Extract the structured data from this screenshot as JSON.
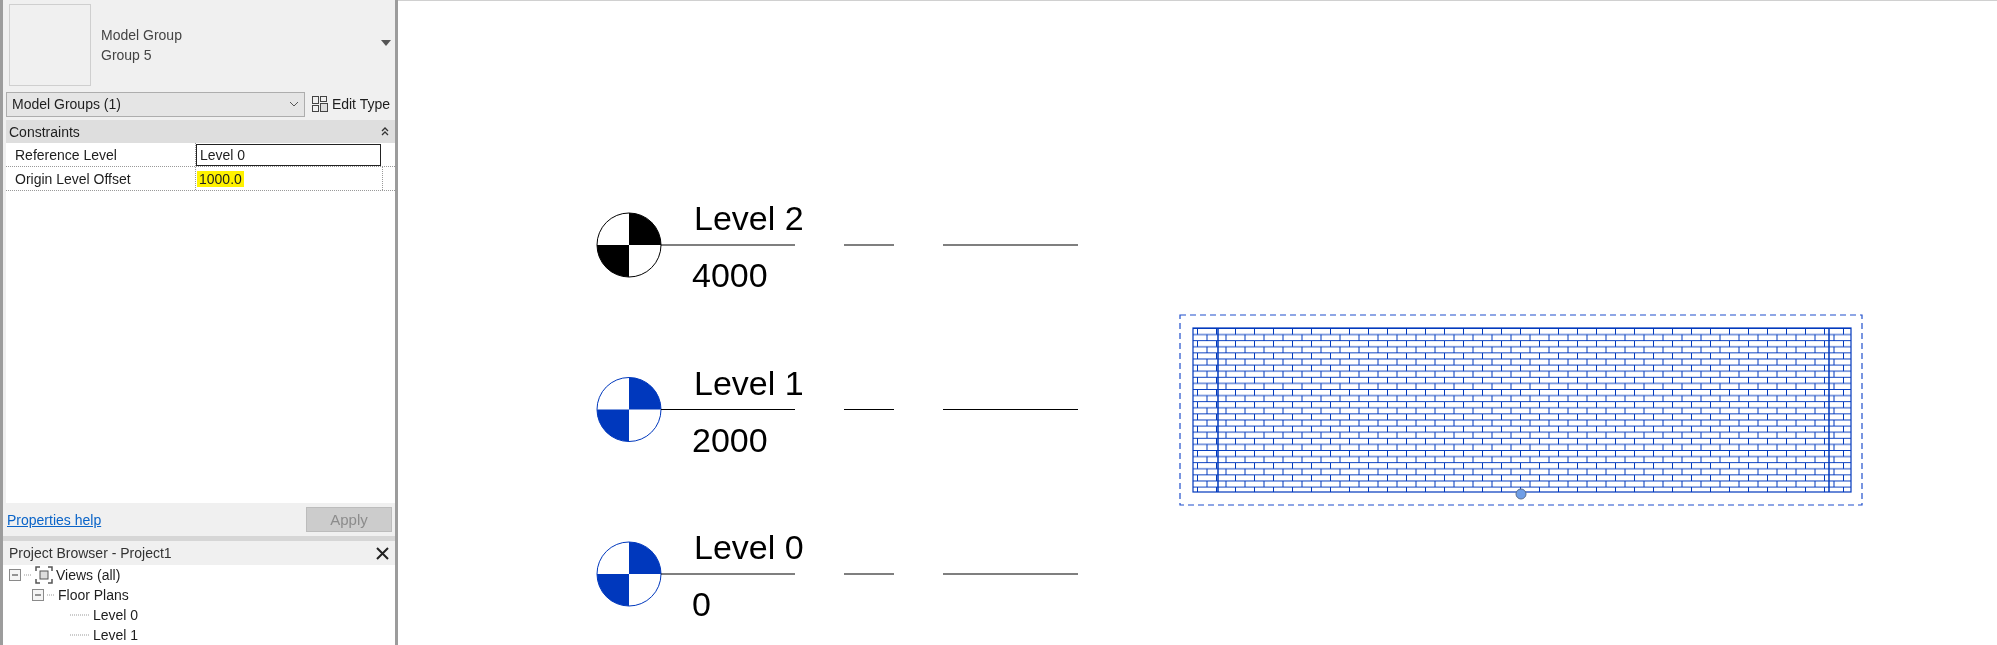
{
  "properties": {
    "type_preview": {
      "family": "Model Group",
      "type": "Group 5"
    },
    "selector": "Model Groups (1)",
    "edit_type": "Edit Type",
    "sections": [
      {
        "title": "Constraints",
        "expanded": true,
        "rows": [
          {
            "label": "Reference Level",
            "value": "Level 0",
            "editing": true,
            "highlighted": false
          },
          {
            "label": "Origin Level Offset",
            "value": "1000.0",
            "editing": false,
            "highlighted": true
          }
        ]
      }
    ],
    "help_link": "Properties help",
    "apply": {
      "label": "Apply",
      "disabled": true
    }
  },
  "project_browser": {
    "title": "Project Browser - Project1",
    "tree": [
      {
        "label": "Views (all)",
        "expanded": true,
        "children": [
          {
            "label": "Floor Plans",
            "expanded": true,
            "children": [
              {
                "label": "Level 0"
              },
              {
                "label": "Level 1"
              }
            ]
          }
        ]
      }
    ]
  },
  "canvas": {
    "levels": [
      {
        "name": "Level 2",
        "elevation": "4000",
        "selected": false
      },
      {
        "name": "Level 1",
        "elevation": "2000",
        "selected": true
      },
      {
        "name": "Level 0",
        "elevation": "0",
        "selected": true
      }
    ],
    "group": {
      "selected": true
    }
  }
}
